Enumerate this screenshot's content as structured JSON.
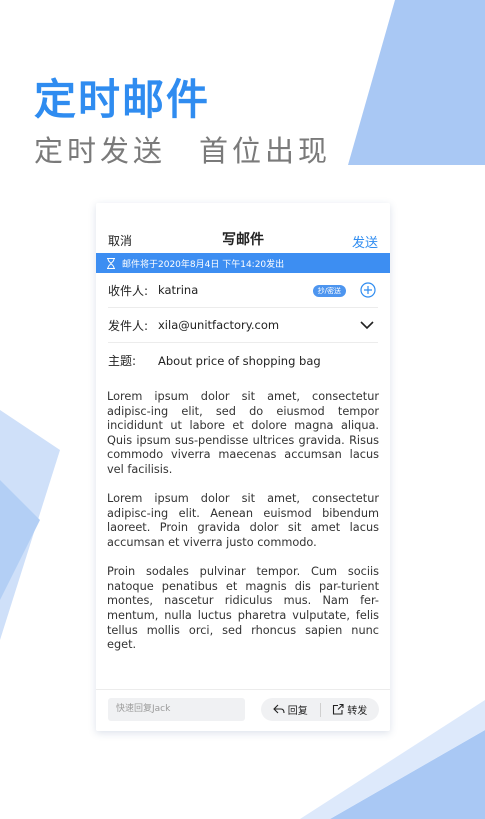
{
  "promo": {
    "headline": "定时邮件",
    "subline": "定时发送　首位出现"
  },
  "compose": {
    "cancel_label": "取消",
    "title": "写邮件",
    "send_label": "发送",
    "schedule_banner": "邮件将于2020年8月4日 下午14:20发出",
    "to_label": "收件人:",
    "to_value": "katrina",
    "cc_label": "抄/密送",
    "from_label": "发件人:",
    "from_value": "xila@unitfactory.com",
    "subject_label": "主题:",
    "subject_value": "About price of shopping bag",
    "body": [
      "Lorem ipsum dolor sit amet, consectetur adipisc-ing elit, sed do eiusmod tempor incididunt ut labore et dolore magna aliqua. Quis ipsum sus-pendisse ultrices gravida. Risus commodo viverra maecenas accumsan lacus vel facilisis.",
      "Lorem ipsum dolor sit amet, consectetur adipisc-ing elit. Aenean euismod bibendum laoreet. Proin gravida dolor sit amet lacus accumsan et viverra justo commodo.",
      "Proin sodales pulvinar tempor. Cum sociis natoque penatibus et magnis dis par-turient montes, nascetur ridiculus mus. Nam fer-mentum, nulla luctus pharetra vulputate, felis tellus mollis orci, sed rhoncus sapien nunc eget."
    ],
    "quick_reply_placeholder": "快速回复Jack",
    "reply_label": "回复",
    "forward_label": "转发"
  },
  "colors": {
    "accent": "#2f8cf0",
    "banner": "#3d8ef2",
    "shape_light": "#dde9fb",
    "shape_mid": "#a9c8f4"
  }
}
